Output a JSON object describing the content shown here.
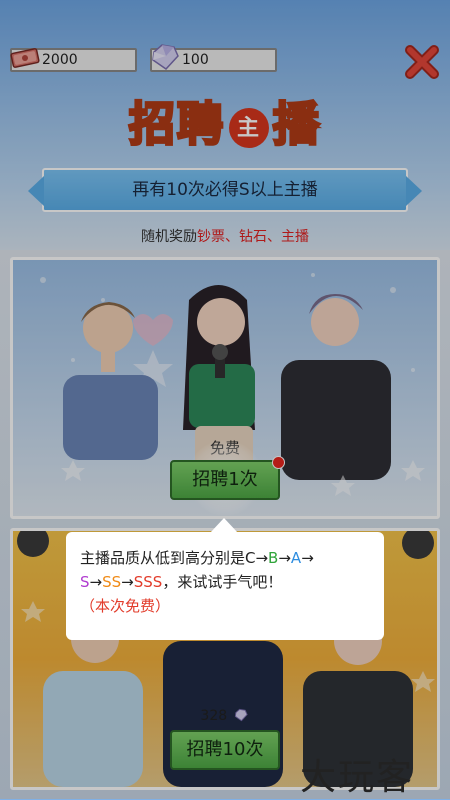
{
  "resources": {
    "cash": "2000",
    "diamond": "100"
  },
  "title": {
    "left": "招聘",
    "middle": "主",
    "right": "播"
  },
  "banner_text": "再有10次必得S以上主播",
  "rewards": {
    "prefix": "随机奖励",
    "items": "钞票、钻石、主播"
  },
  "recruit_single": {
    "free_label": "免费",
    "button_label": "招聘1次"
  },
  "recruit_ten": {
    "cost": "328",
    "button_label": "招聘10次"
  },
  "tip": {
    "line1_prefix": "主播品质从低到高分别是C→",
    "b": "B",
    "arrow1": "→",
    "a": "A",
    "arrow2": "→",
    "s": "S",
    "arrow3": "→",
    "ss": "SS",
    "arrow4": "→",
    "sss": "SSS",
    "suffix": "，来试试手气吧！",
    "note": "（本次免费）"
  },
  "watermark": "大玩客",
  "colors": {
    "accent_red": "#e02020",
    "button_green": "#4ea845",
    "banner_blue": "#5aaee8"
  }
}
